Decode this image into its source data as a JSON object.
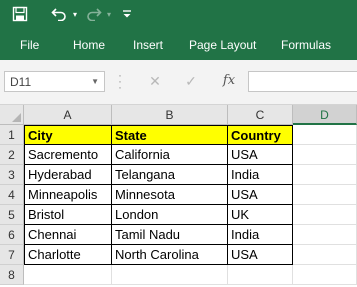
{
  "quick_access": {
    "save_icon": "save-icon",
    "undo_icon": "undo-icon",
    "redo_icon": "redo-icon",
    "customize_icon": "customize-qat-icon"
  },
  "ribbon": {
    "tabs": [
      "File",
      "Home",
      "Insert",
      "Page Layout",
      "Formulas"
    ]
  },
  "formula_bar": {
    "name_box": "D11",
    "fx_label": "fx",
    "formula_value": ""
  },
  "grid": {
    "columns": [
      "A",
      "B",
      "C",
      "D"
    ],
    "rows": [
      "1",
      "2",
      "3",
      "4",
      "5",
      "6",
      "7",
      "8"
    ],
    "selected_column": "D",
    "header_fill": "#ffff00",
    "table": {
      "headers": [
        "City",
        "State",
        "Country"
      ],
      "rows": [
        [
          "Sacremento",
          "California",
          "USA"
        ],
        [
          "Hyderabad",
          "Telangana",
          "India"
        ],
        [
          "Minneapolis",
          "Minnesota",
          "USA"
        ],
        [
          "Bristol",
          "London",
          "UK"
        ],
        [
          "Chennai",
          "Tamil Nadu",
          "India"
        ],
        [
          "Charlotte",
          "North Carolina",
          "USA"
        ]
      ]
    }
  },
  "colors": {
    "excel_green": "#217346"
  }
}
